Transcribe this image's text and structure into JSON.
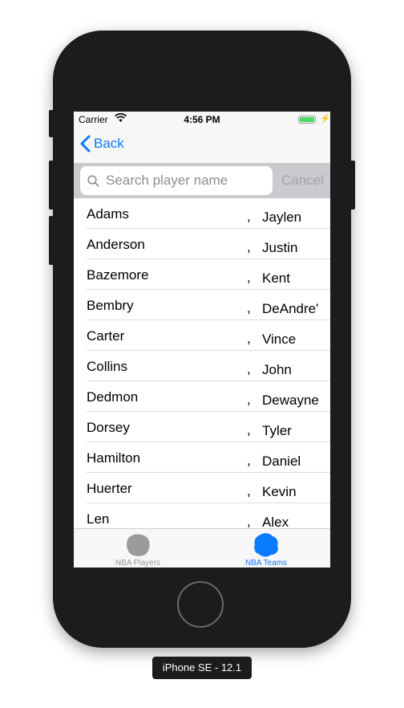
{
  "status_bar": {
    "carrier": "Carrier",
    "time": "4:56 PM"
  },
  "nav": {
    "back_label": "Back"
  },
  "search": {
    "placeholder": "Search player name",
    "cancel_label": "Cancel"
  },
  "players": [
    {
      "last": "Adams",
      "comma": ",",
      "first": "Jaylen"
    },
    {
      "last": "Anderson",
      "comma": ",",
      "first": "Justin"
    },
    {
      "last": "Bazemore",
      "comma": ",",
      "first": "Kent"
    },
    {
      "last": "Bembry",
      "comma": ",",
      "first": "DeAndre'"
    },
    {
      "last": "Carter",
      "comma": ",",
      "first": "Vince"
    },
    {
      "last": "Collins",
      "comma": ",",
      "first": "John"
    },
    {
      "last": "Dedmon",
      "comma": ",",
      "first": "Dewayne"
    },
    {
      "last": "Dorsey",
      "comma": ",",
      "first": "Tyler"
    },
    {
      "last": "Hamilton",
      "comma": ",",
      "first": "Daniel"
    },
    {
      "last": "Huerter",
      "comma": ",",
      "first": "Kevin"
    },
    {
      "last": "Len",
      "comma": ",",
      "first": "Alex"
    }
  ],
  "tabs": [
    {
      "label": "NBA Players",
      "icon": "basketball-player-icon",
      "selected": false,
      "color": "#9b9b9b"
    },
    {
      "label": "NBA Teams",
      "icon": "basketball-team-icon",
      "selected": true,
      "color": "#0a7aff"
    }
  ],
  "device": {
    "label": "iPhone SE - 12.1"
  },
  "colors": {
    "accent": "#0a7aff",
    "battery": "#4cd964",
    "search_bar_bg": "#c9c9ce"
  }
}
